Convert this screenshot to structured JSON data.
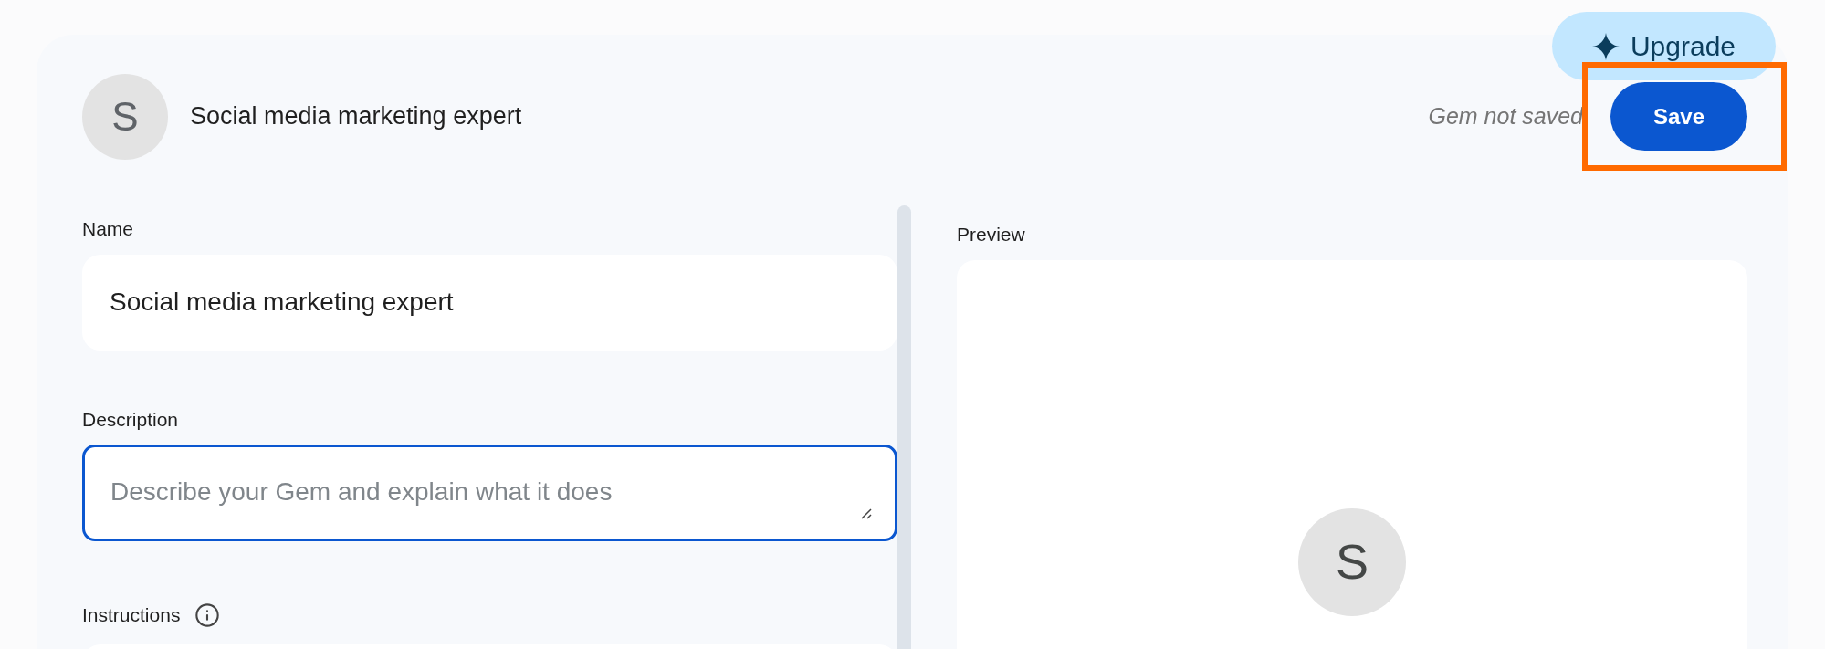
{
  "upgrade_button": {
    "label": "Upgrade"
  },
  "header": {
    "avatar_letter": "S",
    "title": "Social media marketing expert",
    "save_status": "Gem not saved",
    "save_button": "Save"
  },
  "form": {
    "name": {
      "label": "Name",
      "value": "Social media marketing expert"
    },
    "description": {
      "label": "Description",
      "placeholder": "Describe your Gem and explain what it does",
      "focused": true
    },
    "instructions": {
      "label": "Instructions"
    }
  },
  "preview": {
    "label": "Preview",
    "avatar_letter": "S"
  }
}
